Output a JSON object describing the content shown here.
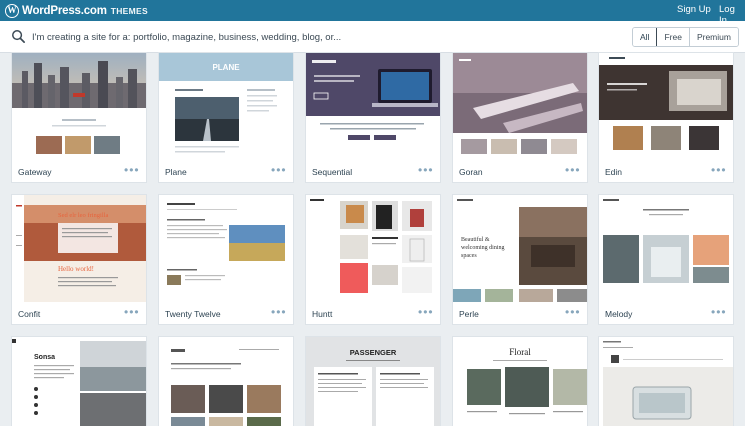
{
  "header": {
    "brand": "WordPress.com",
    "section": "THEMES",
    "logo_letter": "W",
    "signup": "Sign Up",
    "login": "Log In",
    "color": "#21759b"
  },
  "search": {
    "placeholder": "I'm creating a site for a: portfolio, magazine, business, wedding, blog, or..."
  },
  "filters": [
    "All",
    "Free",
    "Premium"
  ],
  "active_filter": "All",
  "themes": [
    {
      "name": "Gateway",
      "more": "•••"
    },
    {
      "name": "Plane",
      "more": "•••"
    },
    {
      "name": "Sequential",
      "more": "•••"
    },
    {
      "name": "Goran",
      "more": "•••"
    },
    {
      "name": "Edin",
      "more": "•••"
    },
    {
      "name": "Confit",
      "more": "•••"
    },
    {
      "name": "Twenty Twelve",
      "more": "•••"
    },
    {
      "name": "Huntt",
      "more": "•••"
    },
    {
      "name": "Perle",
      "more": "•••"
    },
    {
      "name": "Melody",
      "more": "•••"
    },
    {
      "name": "",
      "more": ""
    },
    {
      "name": "",
      "more": ""
    },
    {
      "name": "",
      "more": ""
    },
    {
      "name": "",
      "more": ""
    },
    {
      "name": "",
      "more": ""
    }
  ],
  "preview_text": {
    "plane_title": "PLANE",
    "confit_title": "Sed elr leo fringilla",
    "confit_hello": "Hello world!",
    "perle_title": "Beautiful & welcoming dining spaces",
    "passenger_title": "PASSENGER",
    "floral_title": "Floral",
    "sonsa_title": "Sonsa"
  }
}
